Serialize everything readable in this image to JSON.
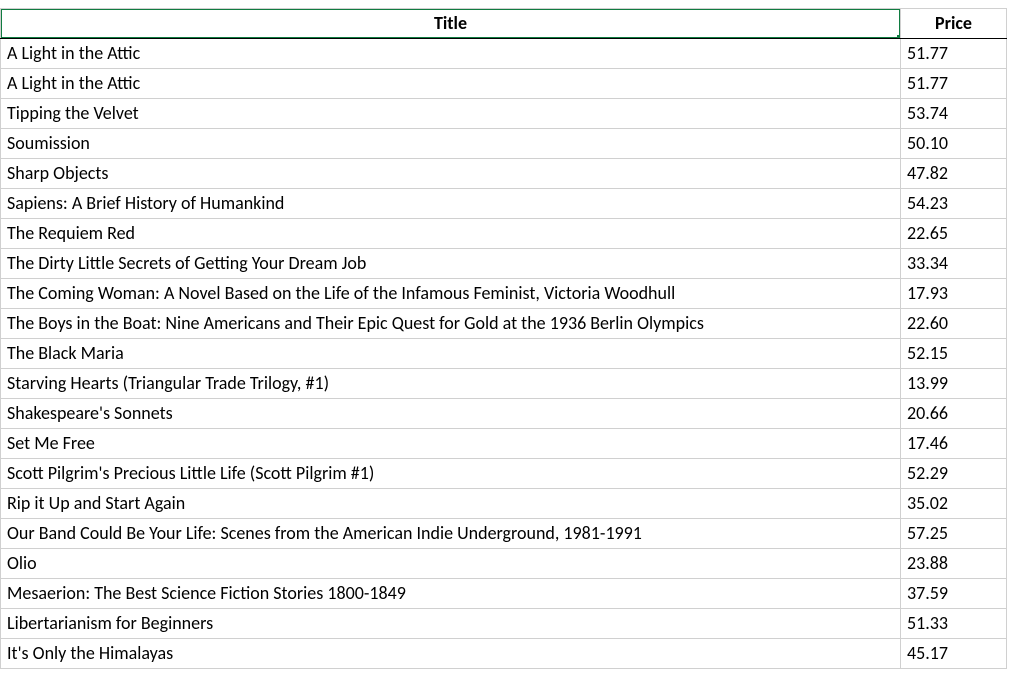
{
  "headers": {
    "title": "Title",
    "price": "Price"
  },
  "rows": [
    {
      "title": "A Light in the Attic",
      "price": "51.77"
    },
    {
      "title": "A Light in the Attic",
      "price": "51.77"
    },
    {
      "title": "Tipping the Velvet",
      "price": "53.74"
    },
    {
      "title": "Soumission",
      "price": "50.10"
    },
    {
      "title": "Sharp Objects",
      "price": "47.82"
    },
    {
      "title": "Sapiens: A Brief History of Humankind",
      "price": "54.23"
    },
    {
      "title": "The Requiem Red",
      "price": "22.65"
    },
    {
      "title": "The Dirty Little Secrets of Getting Your Dream Job",
      "price": "33.34"
    },
    {
      "title": "The Coming Woman: A Novel Based on the Life of the Infamous Feminist, Victoria Woodhull",
      "price": "17.93"
    },
    {
      "title": "The Boys in the Boat: Nine Americans and Their Epic Quest for Gold at the 1936 Berlin Olympics",
      "price": "22.60"
    },
    {
      "title": "The Black Maria",
      "price": "52.15"
    },
    {
      "title": "Starving Hearts (Triangular Trade Trilogy, #1)",
      "price": "13.99"
    },
    {
      "title": "Shakespeare's Sonnets",
      "price": "20.66"
    },
    {
      "title": "Set Me Free",
      "price": "17.46"
    },
    {
      "title": "Scott Pilgrim's Precious Little Life (Scott Pilgrim #1)",
      "price": "52.29"
    },
    {
      "title": "Rip it Up and Start Again",
      "price": "35.02"
    },
    {
      "title": "Our Band Could Be Your Life: Scenes from the American Indie Underground, 1981-1991",
      "price": "57.25"
    },
    {
      "title": "Olio",
      "price": "23.88"
    },
    {
      "title": "Mesaerion: The Best Science Fiction Stories 1800-1849",
      "price": "37.59"
    },
    {
      "title": "Libertarianism for Beginners",
      "price": "51.33"
    },
    {
      "title": "It's Only the Himalayas",
      "price": "45.17"
    }
  ],
  "chart_data": {
    "type": "table",
    "columns": [
      "Title",
      "Price"
    ],
    "rows": [
      [
        "A Light in the Attic",
        51.77
      ],
      [
        "A Light in the Attic",
        51.77
      ],
      [
        "Tipping the Velvet",
        53.74
      ],
      [
        "Soumission",
        50.1
      ],
      [
        "Sharp Objects",
        47.82
      ],
      [
        "Sapiens: A Brief History of Humankind",
        54.23
      ],
      [
        "The Requiem Red",
        22.65
      ],
      [
        "The Dirty Little Secrets of Getting Your Dream Job",
        33.34
      ],
      [
        "The Coming Woman: A Novel Based on the Life of the Infamous Feminist, Victoria Woodhull",
        17.93
      ],
      [
        "The Boys in the Boat: Nine Americans and Their Epic Quest for Gold at the 1936 Berlin Olympics",
        22.6
      ],
      [
        "The Black Maria",
        52.15
      ],
      [
        "Starving Hearts (Triangular Trade Trilogy, #1)",
        13.99
      ],
      [
        "Shakespeare's Sonnets",
        20.66
      ],
      [
        "Set Me Free",
        17.46
      ],
      [
        "Scott Pilgrim's Precious Little Life (Scott Pilgrim #1)",
        52.29
      ],
      [
        "Rip it Up and Start Again",
        35.02
      ],
      [
        "Our Band Could Be Your Life: Scenes from the American Indie Underground, 1981-1991",
        57.25
      ],
      [
        "Olio",
        23.88
      ],
      [
        "Mesaerion: The Best Science Fiction Stories 1800-1849",
        37.59
      ],
      [
        "Libertarianism for Beginners",
        51.33
      ],
      [
        "It's Only the Himalayas",
        45.17
      ]
    ]
  }
}
